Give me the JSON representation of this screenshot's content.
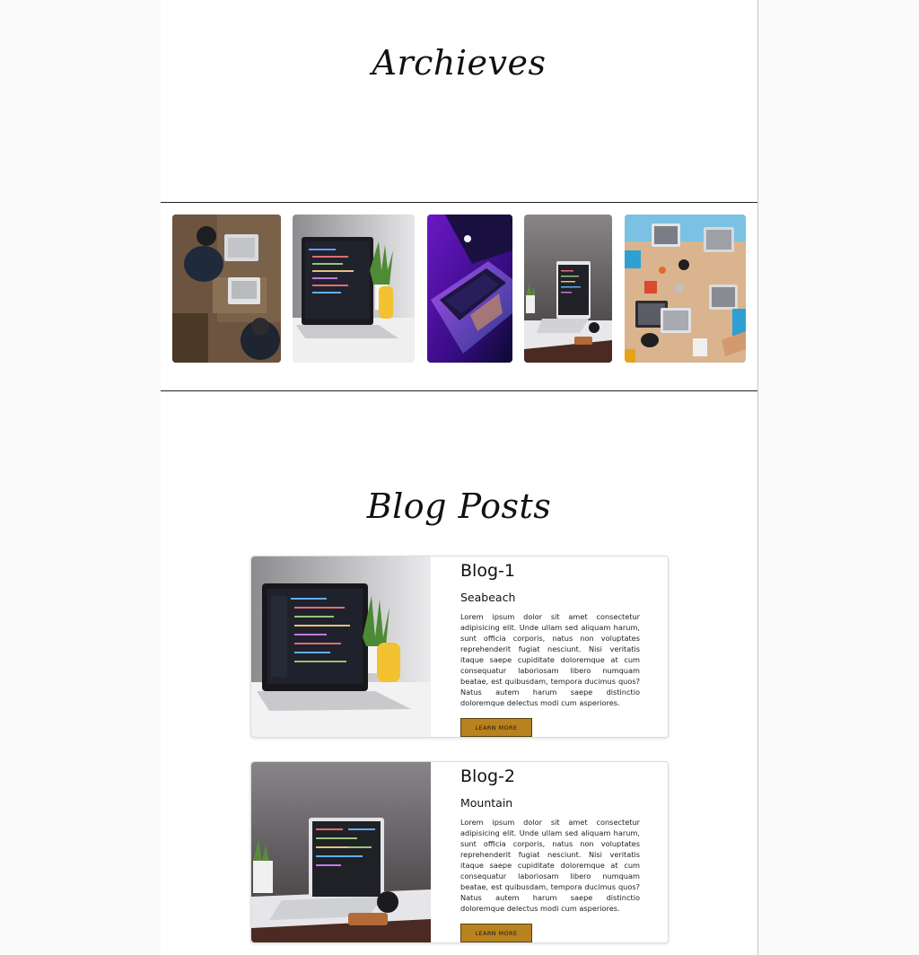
{
  "archives": {
    "title": "Archieves",
    "images": [
      {
        "name": "thumb-people-laptops-desk",
        "desc_icon": "photo"
      },
      {
        "name": "thumb-laptop-code-plant",
        "desc_icon": "photo"
      },
      {
        "name": "thumb-laptop-purple",
        "desc_icon": "photo"
      },
      {
        "name": "thumb-laptop-dark-table",
        "desc_icon": "photo"
      },
      {
        "name": "thumb-team-laptops-table",
        "desc_icon": "photo"
      }
    ]
  },
  "blog": {
    "title": "Blog Posts",
    "posts": [
      {
        "title": "Blog-1",
        "subtitle": "Seabeach",
        "text": "Lorem ipsum dolor sit amet consectetur adipisicing elit. Unde ullam sed aliquam harum, sunt officia corporis, natus non voluptates reprehenderit fugiat nesciunt. Nisi veritatis itaque saepe cupiditate doloremque at cum consequatur laboriosam libero numquam beatae, est quibusdam, tempora ducimus quos? Natus autem harum saepe distinctio doloremque delectus modi cum asperiores.",
        "button": "LEARN MORE"
      },
      {
        "title": "Blog-2",
        "subtitle": "Mountain",
        "text": "Lorem ipsum dolor sit amet consectetur adipisicing elit. Unde ullam sed aliquam harum, sunt officia corporis, natus non voluptates reprehenderit fugiat nesciunt. Nisi veritatis itaque saepe cupiditate doloremque at cum consequatur laboriosam libero numquam beatae, est quibusdam, tempora ducimus quos? Natus autem harum saepe distinctio doloremque delectus modi cum asperiores.",
        "button": "LEARN MORE"
      }
    ]
  },
  "colors": {
    "accent_button": "#b8821e",
    "page_bg": "#ffffff",
    "outer_bg": "#fafafa"
  }
}
